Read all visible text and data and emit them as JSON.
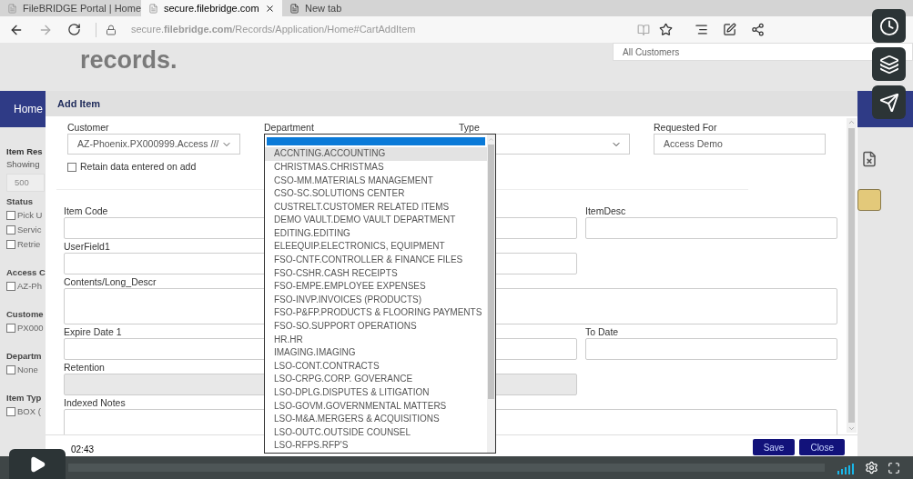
{
  "browser": {
    "tabs": [
      {
        "label": "FileBRIDGE Portal | Home",
        "selected": false
      },
      {
        "label": "secure.filebridge.com",
        "selected": true
      },
      {
        "label": "New tab",
        "selected": false
      }
    ],
    "url": "secure.**filebridge.com**/Records/Application/Home#CartAddItem"
  },
  "page": {
    "logo": "records.",
    "customer_filter": "All Customers",
    "nav_item": "Home"
  },
  "sidebar": {
    "title": "Item Res",
    "showing": "Showing",
    "page_size": "500",
    "groups": [
      {
        "title": "Status",
        "options": [
          {
            "label": "Pick U",
            "checked": false
          },
          {
            "label": "Servic",
            "checked": false
          },
          {
            "label": "Retrie",
            "checked": false
          }
        ]
      },
      {
        "title": "Access C",
        "options": [
          {
            "label": "AZ-Ph",
            "checked": false
          }
        ]
      },
      {
        "title": "Custome",
        "options": [
          {
            "label": "PX000",
            "checked": false
          }
        ]
      },
      {
        "title": "Departm",
        "options": [
          {
            "label": "None",
            "checked": false
          }
        ]
      },
      {
        "title": "Item Typ",
        "options": [
          {
            "label": "BOX (",
            "checked": false
          }
        ]
      }
    ]
  },
  "modal": {
    "title": "Add Item",
    "customer": {
      "label": "Customer",
      "value": "AZ-Phoenix.PX000999.Access ///"
    },
    "retain": {
      "label": "Retain data entered on add",
      "checked": false
    },
    "department": {
      "label": "Department"
    },
    "type": {
      "label": "Type"
    },
    "requested_for": {
      "label": "Requested For",
      "value": "Access Demo"
    },
    "rows": [
      {
        "fields": [
          {
            "label": "Item Code",
            "kind": "input"
          },
          {
            "label": "ItemDesc",
            "kind": "input"
          }
        ]
      },
      {
        "fields": [
          {
            "label": "UserField1",
            "kind": "input"
          }
        ]
      },
      {
        "fields": [
          {
            "label": "Contents/Long_Descr",
            "kind": "textarea"
          }
        ]
      },
      {
        "fields": [
          {
            "label": "Expire Date 1",
            "kind": "input"
          },
          {
            "label": "To Date",
            "kind": "input"
          }
        ]
      },
      {
        "fields": [
          {
            "label": "Retention",
            "kind": "readonly"
          }
        ]
      },
      {
        "fields": [
          {
            "label": "Indexed Notes",
            "kind": "textarea"
          }
        ]
      }
    ],
    "buttons": [
      "Save",
      "Close"
    ]
  },
  "department_list": {
    "blank_selected": true,
    "options": [
      {
        "label": "ACCNTING.ACCOUNTING",
        "hovered": true
      },
      {
        "label": "CHRISTMAS.CHRISTMAS",
        "hovered": false
      },
      {
        "label": "CSO-MM.MATERIALS MANAGEMENT",
        "hovered": false
      },
      {
        "label": "CSO-SC.SOLUTIONS CENTER",
        "hovered": false
      },
      {
        "label": "CUSTRELT.CUSTOMER RELATED ITEMS",
        "hovered": false
      },
      {
        "label": "DEMO VAULT.DEMO VAULT DEPARTMENT",
        "hovered": false
      },
      {
        "label": "EDITING.EDITING",
        "hovered": false
      },
      {
        "label": "ELEEQUIP.ELECTRONICS, EQUIPMENT",
        "hovered": false
      },
      {
        "label": "FSO-CNTF.CONTROLLER & FINANCE FILES",
        "hovered": false
      },
      {
        "label": "FSO-CSHR.CASH RECEIPTS",
        "hovered": false
      },
      {
        "label": "FSO-EMPE.EMPLOYEE EXPENSES",
        "hovered": false
      },
      {
        "label": "FSO-INVP.INVOICES (PRODUCTS)",
        "hovered": false
      },
      {
        "label": "FSO-P&FP.PRODUCTS & FLOORING PAYMENTS",
        "hovered": false
      },
      {
        "label": "FSO-SO.SUPPORT OPERATIONS",
        "hovered": false
      },
      {
        "label": "HR.HR",
        "hovered": false
      },
      {
        "label": "IMAGING.IMAGING",
        "hovered": false
      },
      {
        "label": "LSO-CONT.CONTRACTS",
        "hovered": false
      },
      {
        "label": "LSO-CRPG.CORP. GOVERANCE",
        "hovered": false
      },
      {
        "label": "LSO-DPLG.DISPUTES & LITIGATION",
        "hovered": false
      },
      {
        "label": "LSO-GOVM.GOVERNMENTAL MATTERS",
        "hovered": false
      },
      {
        "label": "LSO-M&A.MERGERS & ACQUISITIONS",
        "hovered": false
      },
      {
        "label": "LSO-OUTC.OUTSIDE COUNSEL",
        "hovered": false
      },
      {
        "label": "LSO-RFPS.RFP'S",
        "hovered": false
      }
    ]
  },
  "video": {
    "time": "02:43"
  }
}
